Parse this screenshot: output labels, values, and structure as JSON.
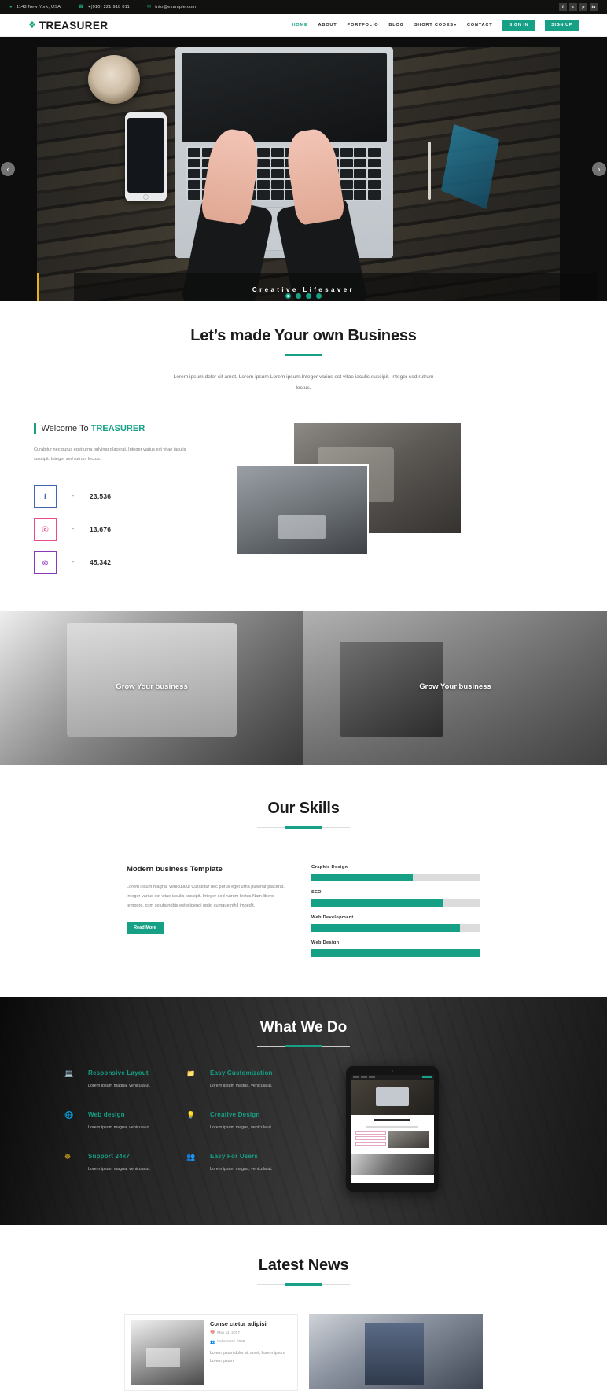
{
  "topbar": {
    "address": "1143 New York, USA",
    "phone": "+(010) 221 918 811",
    "email": "info@example.com",
    "address_icon": "map-pin-icon",
    "phone_icon": "phone-icon",
    "email_icon": "envelope-icon",
    "social": [
      {
        "name": "facebook",
        "glyph": "f"
      },
      {
        "name": "twitter",
        "glyph": "t"
      },
      {
        "name": "pinterest",
        "glyph": "p"
      },
      {
        "name": "linkedin",
        "glyph": "in"
      }
    ]
  },
  "header": {
    "logo_text": "TREASURER",
    "logo_icon": "compass-diamond-icon",
    "nav": [
      {
        "label": "HOME",
        "active": true
      },
      {
        "label": "ABOUT",
        "active": false
      },
      {
        "label": "PORTFOLIO",
        "active": false
      },
      {
        "label": "BLOG",
        "active": false
      },
      {
        "label": "SHORT CODES",
        "active": false,
        "caret": "▾"
      },
      {
        "label": "CONTACT",
        "active": false
      }
    ],
    "sign_in": "SIGN IN",
    "sign_up": "SIGN UP"
  },
  "hero": {
    "caption": "Creative Lifesaver",
    "prev_icon": "chevron-left-icon",
    "next_icon": "chevron-right-icon",
    "prev_glyph": "‹",
    "next_glyph": "›",
    "slide_count": 4,
    "active_slide": 1
  },
  "intro": {
    "title": "Let’s made Your own Business",
    "subtitle": "Lorem ipsum dolor sit amet, Lorem ipsum Lorem ipsum.Integer varius est vitae iaculis suscipit. Integer sed rutrum lectus."
  },
  "welcome": {
    "title_prefix": "Welcome To ",
    "title_brand": "TREASURER",
    "text": "Curabitur nec purus eget urna pulvinar placerat. Integer varius est vitae iaculis suscipit. Integer sed rutrum lectus.",
    "counters": [
      {
        "network": "facebook",
        "glyph": "f",
        "color": "#4267b2",
        "dash": "-",
        "value": "23,536"
      },
      {
        "network": "dribbble",
        "glyph": "ⓓ",
        "color": "#ea4c89",
        "dash": "-",
        "value": "13,676"
      },
      {
        "network": "instagram",
        "glyph": "◎",
        "color": "#8a3ab9",
        "dash": "-",
        "value": "45,342"
      }
    ]
  },
  "grow": {
    "left_label": "Grow Your business",
    "right_label": "Grow Your business"
  },
  "skills": {
    "title": "Our Skills",
    "heading": "Modern business Template",
    "text": "Lorem ipsum magna, vehicula ut Curabitur nec purus eget urna pulvinar placerat. Integer varius est vitae iaculis suscipit. Integer sed rutrum lectus.Nam libero tempore, cum soluta nobis est eligendi optio cumque nihil impedit.",
    "read_more": "Read More"
  },
  "chart_data": {
    "type": "bar",
    "title": "Our Skills",
    "orientation": "horizontal",
    "categories": [
      "Graphic Design",
      "SEO",
      "Web Development",
      "Web Design"
    ],
    "values": [
      60,
      78,
      88,
      100
    ],
    "xlabel": "",
    "ylabel": "",
    "xlim": [
      0,
      100
    ],
    "unit": "%",
    "grid": false,
    "legend": false,
    "bar_color": "#16a085",
    "track_color": "#dcdcdc"
  },
  "what_we_do": {
    "title": "What We Do",
    "items": [
      {
        "icon": "laptop-icon",
        "glyph": "💻",
        "title": "Responsive Layout",
        "text": "Lorem ipsum magna, vehicula ut."
      },
      {
        "icon": "folder-icon",
        "glyph": "📁",
        "title": "Easy Customization",
        "text": "Lorem ipsum magna, vehicula ut."
      },
      {
        "icon": "globe-icon",
        "glyph": "🌐",
        "title": "Web design",
        "text": "Lorem ipsum magna, vehicula ut."
      },
      {
        "icon": "lightbulb-icon",
        "glyph": "💡",
        "title": "Creative Design",
        "text": "Lorem ipsum magna, vehicula ut."
      },
      {
        "icon": "lifebuoy-icon",
        "glyph": "☸",
        "title": "Support 24x7",
        "text": "Lorem ipsum magna, vehicula ut."
      },
      {
        "icon": "users-icon",
        "glyph": "👥",
        "title": "Easy For Users",
        "text": "Lorem ipsum magna, vehicula ut."
      }
    ],
    "device_mockup": "tablet-device-mockup"
  },
  "news": {
    "title": "Latest News",
    "card": {
      "heading": "Conse ctetur adipisi",
      "date_icon": "calendar-icon",
      "date": "May 11, 2017",
      "followers_icon": "users-icon",
      "followers": "Followers : 7665",
      "text": "Lorem ipsum dolor sit amet, Lorem ipsum Lorem ipsum."
    }
  },
  "theme": {
    "accent": "#16a085",
    "dark": "#111110",
    "gold": "#e8b11e",
    "text": "#2b2b2b",
    "muted": "#7c7c7c"
  }
}
